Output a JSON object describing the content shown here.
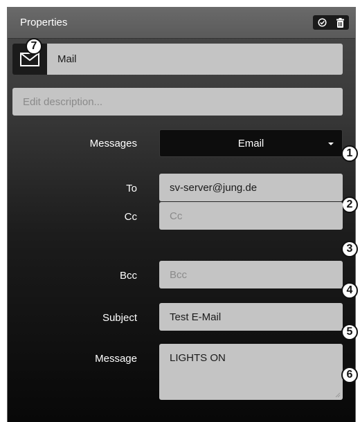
{
  "header": {
    "title": "Properties",
    "icons": [
      "check-circle-icon",
      "trash-icon"
    ]
  },
  "mail": {
    "icon": "envelope-icon",
    "name": "Mail",
    "badge": "7"
  },
  "description": {
    "placeholder": "Edit description..."
  },
  "messages": {
    "label": "Messages",
    "value": "Email",
    "badge": "1"
  },
  "to": {
    "label": "To",
    "value": "sv-server@jung.de",
    "badge": "2"
  },
  "cc": {
    "label": "Cc",
    "placeholder": "Cc",
    "badge": "3"
  },
  "bcc": {
    "label": "Bcc",
    "placeholder": "Bcc",
    "badge": "4"
  },
  "subject": {
    "label": "Subject",
    "value": "Test E-Mail",
    "badge": "5"
  },
  "message": {
    "label": "Message",
    "value": "LIGHTS ON",
    "badge": "6"
  },
  "colors": {
    "panel_top": "#4a4a4a",
    "panel_bottom": "#080808",
    "field": "#c4c4c4",
    "header": "#636363"
  }
}
